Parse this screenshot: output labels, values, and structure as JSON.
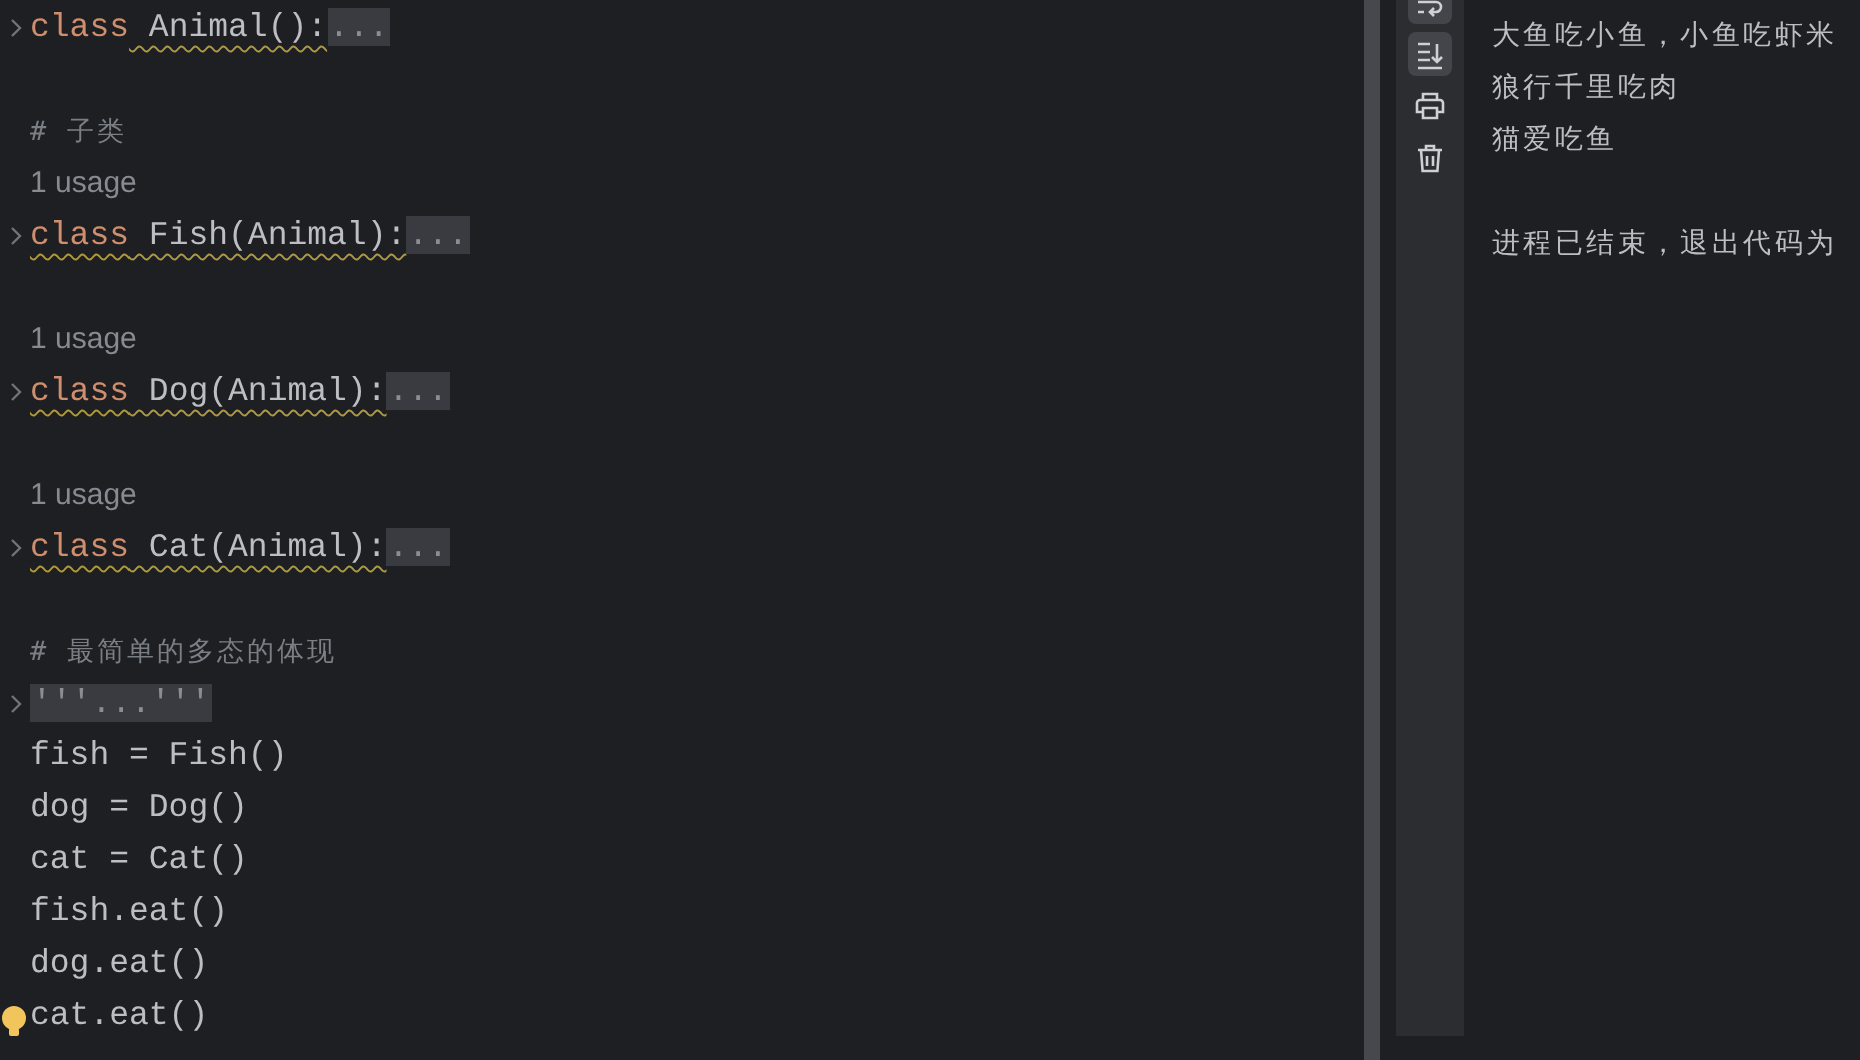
{
  "editor": {
    "lines": [
      {
        "kind": "code",
        "foldable": true,
        "segments": [
          {
            "kind": "keyword",
            "text": "class"
          },
          {
            "kind": "plain",
            "text": " Animal():",
            "squiggle": true
          },
          {
            "kind": "fold",
            "text": "..."
          }
        ]
      },
      {
        "kind": "blank"
      },
      {
        "kind": "comment",
        "text": "# 子类"
      },
      {
        "kind": "usage",
        "text": "1 usage"
      },
      {
        "kind": "code",
        "foldable": true,
        "segments": [
          {
            "kind": "keyword",
            "text": "class",
            "squiggle": true
          },
          {
            "kind": "plain",
            "text": " Fish(Animal):",
            "squiggle": true
          },
          {
            "kind": "fold",
            "text": "..."
          }
        ]
      },
      {
        "kind": "blank"
      },
      {
        "kind": "usage",
        "text": "1 usage"
      },
      {
        "kind": "code",
        "foldable": true,
        "segments": [
          {
            "kind": "keyword",
            "text": "class",
            "squiggle": true
          },
          {
            "kind": "plain",
            "text": " Dog(Animal):",
            "squiggle": true
          },
          {
            "kind": "fold",
            "text": "..."
          }
        ]
      },
      {
        "kind": "blank"
      },
      {
        "kind": "usage",
        "text": "1 usage"
      },
      {
        "kind": "code",
        "foldable": true,
        "segments": [
          {
            "kind": "keyword",
            "text": "class",
            "squiggle": true
          },
          {
            "kind": "plain",
            "text": " Cat(Animal):",
            "squiggle": true
          },
          {
            "kind": "fold",
            "text": "..."
          }
        ]
      },
      {
        "kind": "blank"
      },
      {
        "kind": "comment",
        "text": "# 最简单的多态的体现"
      },
      {
        "kind": "code",
        "foldable": true,
        "segments": [
          {
            "kind": "fold",
            "text": "'''...'''"
          }
        ]
      },
      {
        "kind": "code",
        "foldable": false,
        "segments": [
          {
            "kind": "plain",
            "text": "fish = Fish()"
          }
        ]
      },
      {
        "kind": "code",
        "foldable": false,
        "segments": [
          {
            "kind": "plain",
            "text": "dog = Dog()"
          }
        ]
      },
      {
        "kind": "code",
        "foldable": false,
        "segments": [
          {
            "kind": "plain",
            "text": "cat = Cat()"
          }
        ]
      },
      {
        "kind": "code",
        "foldable": false,
        "segments": [
          {
            "kind": "plain",
            "text": "fish.eat()"
          }
        ]
      },
      {
        "kind": "code",
        "foldable": false,
        "segments": [
          {
            "kind": "plain",
            "text": "dog.eat()"
          }
        ]
      },
      {
        "kind": "code",
        "foldable": false,
        "bulb": true,
        "segments": [
          {
            "kind": "plain",
            "text": "cat.eat()"
          }
        ]
      }
    ]
  },
  "run_toolbar": [
    {
      "kind": "soft-wrap",
      "selected": true
    },
    {
      "kind": "scroll-end",
      "selected": true
    },
    {
      "kind": "print",
      "selected": false
    },
    {
      "kind": "trash",
      "selected": false
    }
  ],
  "output": {
    "lines": [
      {
        "kind": "text",
        "text": "大鱼吃小鱼，小鱼吃虾米"
      },
      {
        "kind": "text",
        "text": "狼行千里吃肉"
      },
      {
        "kind": "text",
        "text": "猫爱吃鱼"
      },
      {
        "kind": "blank"
      },
      {
        "kind": "text",
        "text": "进程已结束，退出代码为"
      }
    ]
  }
}
